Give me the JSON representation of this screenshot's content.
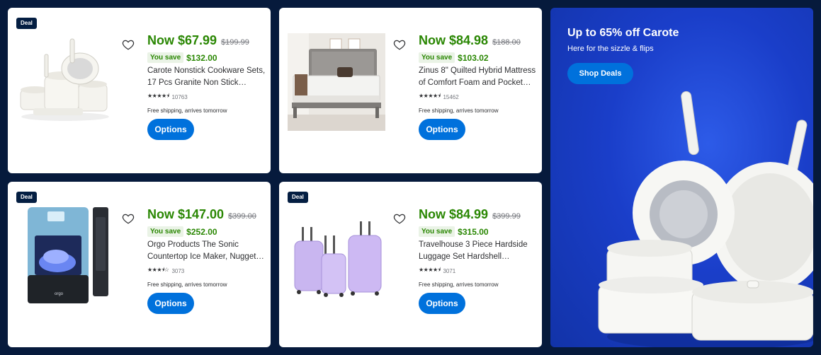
{
  "products": [
    {
      "deal_badge": "Deal",
      "price_now": "Now $67.99",
      "price_was": "$199.99",
      "you_save_label": "You save",
      "you_save_amount": "$132.00",
      "title": "Carote Nonstick Cookware Sets, 17 Pcs Granite Non Stick Cookware Set",
      "rating_count": "10763",
      "rating_value": 4.5,
      "shipping": "Free shipping, arrives tomorrow",
      "button_label": "Options",
      "image_icon": "cookware-set-image"
    },
    {
      "deal_badge": "",
      "price_now": "Now $84.98",
      "price_was": "$188.00",
      "you_save_label": "You save",
      "you_save_amount": "$103.02",
      "title": "Zinus 8\" Quilted Hybrid Mattress of Comfort Foam and Pocket Springs",
      "rating_count": "15462",
      "rating_value": 4.5,
      "shipping": "Free shipping, arrives tomorrow",
      "button_label": "Options",
      "image_icon": "mattress-image"
    },
    {
      "deal_badge": "Deal",
      "price_now": "Now $147.00",
      "price_was": "$399.00",
      "you_save_label": "You save",
      "you_save_amount": "$252.00",
      "title": "Orgo Products The Sonic Countertop Ice Maker, Nugget Ice Type",
      "rating_count": "3073",
      "rating_value": 3.5,
      "shipping": "Free shipping, arrives tomorrow",
      "button_label": "Options",
      "image_icon": "ice-maker-image"
    },
    {
      "deal_badge": "Deal",
      "price_now": "Now $84.99",
      "price_was": "$399.99",
      "you_save_label": "You save",
      "you_save_amount": "$315.00",
      "title": "Travelhouse 3 Piece Hardside Luggage Set Hardshell Lightweight",
      "rating_count": "3071",
      "rating_value": 4.5,
      "shipping": "Free shipping, arrives tomorrow",
      "button_label": "Options",
      "image_icon": "luggage-set-image"
    }
  ],
  "stars": {
    "r45": "★★★★⯨",
    "r35": "★★★⯨☆"
  },
  "promo": {
    "title": "Up to 65% off Carote",
    "subtitle": "Here for the sizzle & flips",
    "button_label": "Shop Deals",
    "image_icon": "carote-cookware-image"
  },
  "colors": {
    "background": "#061a3c",
    "price_green": "#2a8703",
    "button_blue": "#0071dc",
    "badge_navy": "#041e42"
  }
}
